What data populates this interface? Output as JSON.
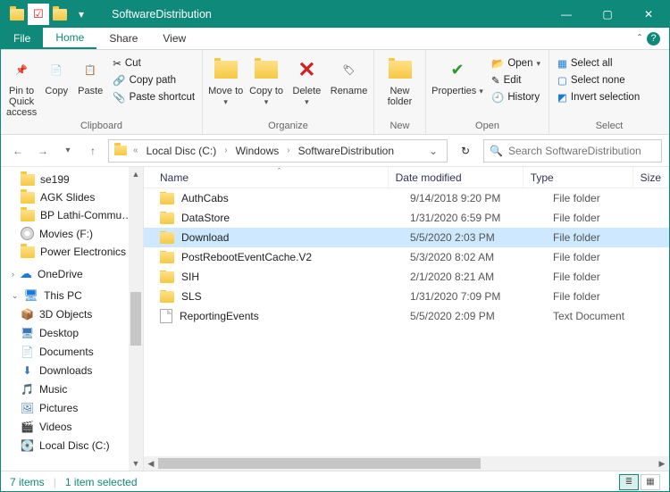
{
  "window": {
    "title": "SoftwareDistribution",
    "min": "—",
    "max": "▢",
    "close": "✕"
  },
  "tabs": {
    "file": "File",
    "home": "Home",
    "share": "Share",
    "view": "View"
  },
  "ribbon": {
    "pin": "Pin to Quick access",
    "copy": "Copy",
    "paste": "Paste",
    "cut": "Cut",
    "copypath": "Copy path",
    "pasteshort": "Paste shortcut",
    "group_clipboard": "Clipboard",
    "moveto": "Move to",
    "copyto": "Copy to",
    "delete": "Delete",
    "rename": "Rename",
    "group_organize": "Organize",
    "newfolder": "New folder",
    "group_new": "New",
    "properties": "Properties",
    "open": "Open",
    "edit": "Edit",
    "history": "History",
    "group_open": "Open",
    "selectall": "Select all",
    "selectnone": "Select none",
    "invert": "Invert selection",
    "group_select": "Select"
  },
  "breadcrumbs": [
    "Local Disc (C:)",
    "Windows",
    "SoftwareDistribution"
  ],
  "search": {
    "placeholder": "Search SoftwareDistribution"
  },
  "nav": {
    "quick": [
      "se199",
      "AGK Slides",
      "BP Lathi-Commu…",
      "Movies (F:)",
      "Power Electronics"
    ],
    "onedrive": "OneDrive",
    "thispc": "This PC",
    "pcitems": [
      "3D Objects",
      "Desktop",
      "Documents",
      "Downloads",
      "Music",
      "Pictures",
      "Videos",
      "Local Disc (C:)"
    ]
  },
  "columns": {
    "name": "Name",
    "date": "Date modified",
    "type": "Type",
    "size": "Size"
  },
  "files": [
    {
      "name": "AuthCabs",
      "date": "9/14/2018 9:20 PM",
      "type": "File folder",
      "kind": "folder",
      "selected": false
    },
    {
      "name": "DataStore",
      "date": "1/31/2020 6:59 PM",
      "type": "File folder",
      "kind": "folder",
      "selected": false
    },
    {
      "name": "Download",
      "date": "5/5/2020 2:03 PM",
      "type": "File folder",
      "kind": "folder",
      "selected": true
    },
    {
      "name": "PostRebootEventCache.V2",
      "date": "5/3/2020 8:02 AM",
      "type": "File folder",
      "kind": "folder",
      "selected": false
    },
    {
      "name": "SIH",
      "date": "2/1/2020 8:21 AM",
      "type": "File folder",
      "kind": "folder",
      "selected": false
    },
    {
      "name": "SLS",
      "date": "1/31/2020 7:09 PM",
      "type": "File folder",
      "kind": "folder",
      "selected": false
    },
    {
      "name": "ReportingEvents",
      "date": "5/5/2020 2:09 PM",
      "type": "Text Document",
      "kind": "file",
      "selected": false
    }
  ],
  "status": {
    "count": "7 items",
    "selected": "1 item selected"
  }
}
